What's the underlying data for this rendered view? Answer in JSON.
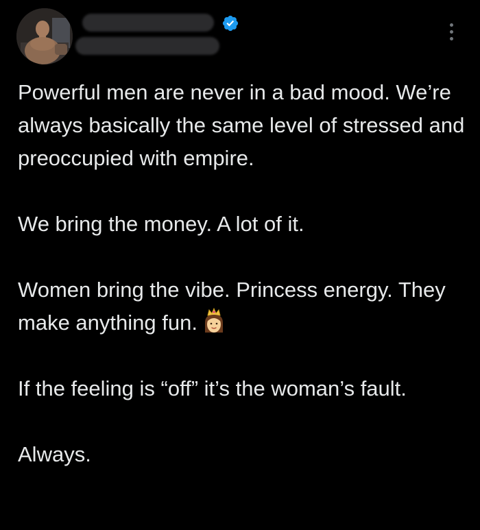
{
  "author": {
    "avatar_icon": "profile-avatar",
    "verified_icon": "verified-badge-icon",
    "verified_color": "#1d9bf0",
    "name_redacted": true,
    "handle_redacted": true
  },
  "menu": {
    "more_icon": "more-vertical-icon"
  },
  "tweet": {
    "paragraphs": [
      "Powerful men are never in a bad mood. We’re always basically the same level of stressed and preoccupied with empire.",
      "We bring the money. A lot of it.",
      "Women bring the vibe. Princess energy. They make anything fun.",
      "If the feeling is “off” it’s the woman’s fault.",
      "Always."
    ],
    "emoji_icon": "princess-emoji-icon"
  },
  "colors": {
    "background": "#000000",
    "text": "#e7e9ea",
    "muted": "#71767b"
  }
}
